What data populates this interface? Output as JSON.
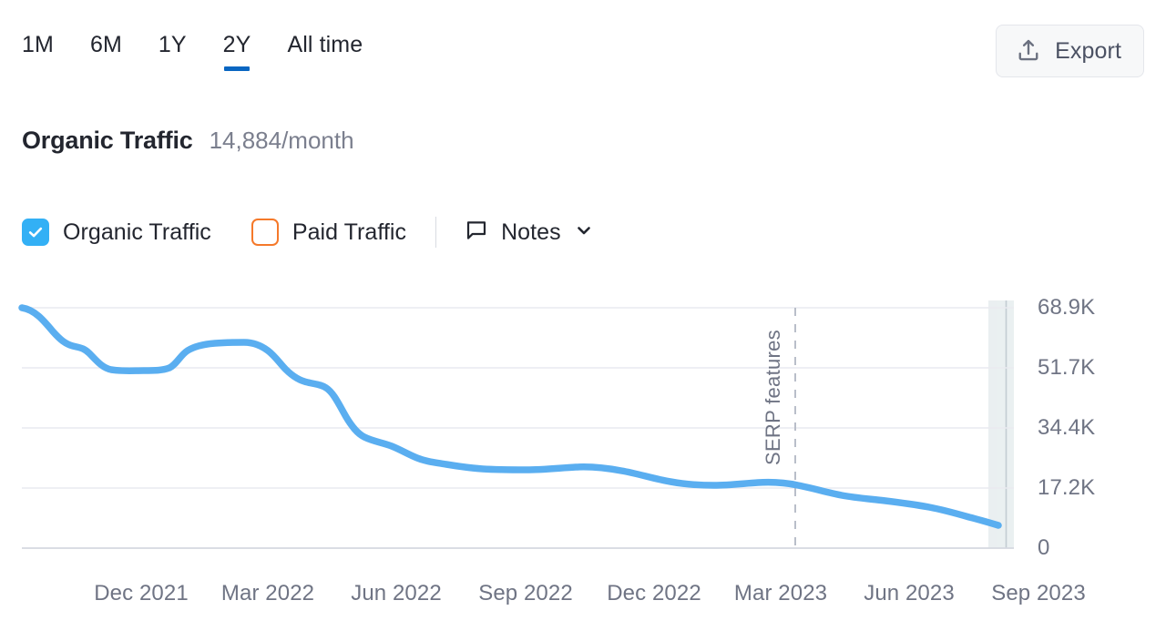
{
  "toolbar": {
    "ranges": [
      {
        "label": "1M",
        "active": false
      },
      {
        "label": "6M",
        "active": false
      },
      {
        "label": "1Y",
        "active": false
      },
      {
        "label": "2Y",
        "active": true
      },
      {
        "label": "All time",
        "active": false
      }
    ],
    "export_label": "Export",
    "export_icon": "upload-icon",
    "active_underline_color": "#0966c2"
  },
  "header": {
    "title": "Organic Traffic",
    "value": "14,884/month"
  },
  "legend": {
    "organic": {
      "label": "Organic Traffic",
      "checked": true,
      "color": "#33b0f5"
    },
    "paid": {
      "label": "Paid Traffic",
      "checked": false,
      "color": "#f5792a"
    },
    "notes": {
      "label": "Notes",
      "icon": "note-bubble-icon",
      "chevron": "chevron-down-icon"
    }
  },
  "chart_data": {
    "type": "line",
    "title": "Organic Traffic",
    "xlabel": "",
    "ylabel": "",
    "ylim": [
      0,
      68900
    ],
    "grid": true,
    "legend_position": "top-left",
    "y_ticks": [
      "0",
      "17.2K",
      "34.4K",
      "51.7K",
      "68.9K"
    ],
    "y_tick_values": [
      0,
      17200,
      34400,
      51700,
      68900
    ],
    "x_ticks": [
      "Dec 2021",
      "Mar 2022",
      "Jun 2022",
      "Sep 2022",
      "Dec 2022",
      "Mar 2023",
      "Jun 2023",
      "Sep 2023"
    ],
    "annotations": [
      {
        "label": "SERP features",
        "type": "vertical-dashed-line",
        "x": "Mar 2023"
      },
      {
        "label": "",
        "type": "shaded-band",
        "x": "Sep 2023",
        "note": "incomplete period highlight"
      }
    ],
    "series": [
      {
        "name": "Organic Traffic",
        "color": "#5aaef0",
        "x": [
          "Oct 2021",
          "Nov 2021",
          "Dec 2021",
          "Jan 2022",
          "Feb 2022",
          "Mar 2022",
          "Apr 2022",
          "May 2022",
          "Jun 2022",
          "Jul 2022",
          "Aug 2022",
          "Sep 2022",
          "Oct 2022",
          "Nov 2022",
          "Dec 2022",
          "Jan 2023",
          "Feb 2023",
          "Mar 2023",
          "Apr 2023",
          "May 2023",
          "Jun 2023",
          "Jul 2023",
          "Aug 2023",
          "Sep 2023"
        ],
        "values": [
          68900,
          62000,
          57500,
          50100,
          50000,
          53000,
          54200,
          54400,
          50500,
          45500,
          44300,
          31500,
          29500,
          25800,
          23800,
          23000,
          22600,
          22000,
          21400,
          20600,
          19800,
          19300,
          18600,
          17400,
          16200,
          14884
        ]
      }
    ]
  }
}
